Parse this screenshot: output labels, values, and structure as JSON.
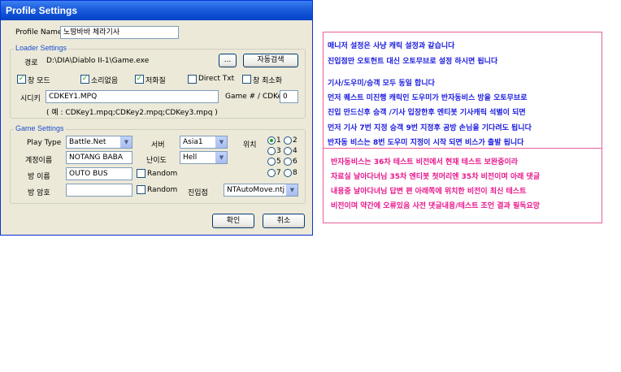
{
  "window": {
    "title": "Profile Settings"
  },
  "profile": {
    "label": "Profile Name",
    "value": "노땅바바 체라기사"
  },
  "loader": {
    "group_title": "Loader Settings",
    "path_label": "경로",
    "path_value": "D:\\DIA\\Diablo II-1\\Game.exe",
    "browse_label": "...",
    "autodetect_label": "자동검색",
    "checkboxes": [
      {
        "label": "창 모드",
        "checked": true
      },
      {
        "label": "소리없음",
        "checked": true
      },
      {
        "label": "저화질",
        "checked": true
      },
      {
        "label": "Direct Txt",
        "checked": false
      },
      {
        "label": "창 최소화",
        "checked": false
      }
    ],
    "cdkey_label": "시디키",
    "cdkey_value": "CDKEY1.MPQ",
    "cdkey_hint": "( 예 : CDKey1.mpq;CDKey2.mpq;CDKey3.mpq )",
    "game_cdkey_label": "Game # / CDKey",
    "game_cdkey_value": "0"
  },
  "game": {
    "group_title": "Game Settings",
    "play_type_label": "Play Type",
    "play_type_value": "Battle.Net",
    "server_label": "서버",
    "server_value": "Asia1",
    "position_label": "위치",
    "account_label": "계정이름",
    "account_value": "NOTANG BABA",
    "difficulty_label": "난이도",
    "difficulty_value": "Hell",
    "room_label": "방 이름",
    "room_value": "OUTO BUS",
    "random1_label": "Random",
    "password_label": "방 암호",
    "password_value": "",
    "random2_label": "Random",
    "entry_label": "진입점",
    "entry_value": "NTAutoMove.ntj",
    "positions": [
      "1",
      "2",
      "3",
      "4",
      "5",
      "6",
      "7",
      "8"
    ],
    "position_selected": "1"
  },
  "buttons": {
    "ok": "확인",
    "cancel": "취소"
  },
  "note": {
    "lines_blue": [
      "매니저 설정은 사냥 캐릭 설정과 같습니다",
      "진입점만 오토헌트 대신 오토무브로 설정 하시면 됩니다",
      "기사/도우미/승객 모두 동일 합니다",
      "먼저 퀘스트 미진행 캐릭인 도우미가 반자동비스 방을 오토무브로",
      "진입 만드신후 승객 /기사 입장한후 엔티봇 기사캐릭 석별이 되면",
      "먼저 기사 7번 지정 승객 9번 지정후 공방 손님을 기다려도 됩니다",
      "반자동 비스는 8번 도우미 지정이 시작 되면 비스가 출발 됩니다"
    ],
    "lines_pink": [
      "반자동비스는 36차 테스트 비전에서 현재 테스트 보완중이라",
      "자료실 날아다녀님 35차 엔티봇 첫머리엔 35차 비전이며 아래 댓글",
      "내용중 날아다녀님 답변 편 아래쪽에 위치한 비전이 최신 테스트",
      "비전이며 약간에 오류있음 사전 댓글내용/테스트 조언 결과 필독요망"
    ],
    "colors": {
      "blue": "#1a1adf",
      "pink": "#e8168c",
      "border": "#e8609a"
    }
  }
}
